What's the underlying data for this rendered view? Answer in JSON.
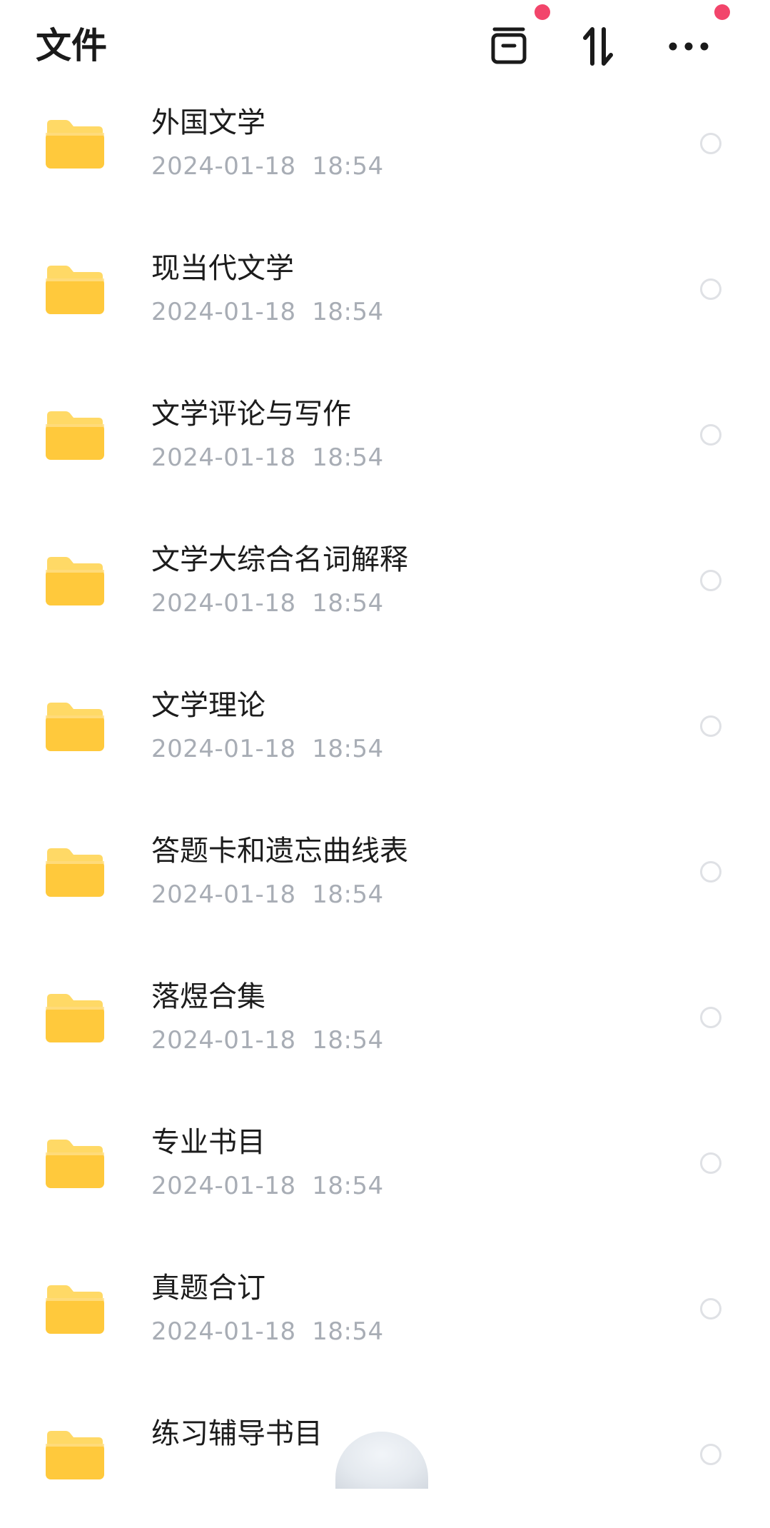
{
  "header": {
    "title": "文件"
  },
  "folders": [
    {
      "name": "外国文学",
      "date": "2024-01-18  18:54"
    },
    {
      "name": "现当代文学",
      "date": "2024-01-18  18:54"
    },
    {
      "name": "文学评论与写作",
      "date": "2024-01-18  18:54"
    },
    {
      "name": "文学大综合名词解释",
      "date": "2024-01-18  18:54"
    },
    {
      "name": "文学理论",
      "date": "2024-01-18  18:54"
    },
    {
      "name": "答题卡和遗忘曲线表",
      "date": "2024-01-18  18:54"
    },
    {
      "name": "落煜合集",
      "date": "2024-01-18  18:54"
    },
    {
      "name": "专业书目",
      "date": "2024-01-18  18:54"
    },
    {
      "name": "真题合订",
      "date": "2024-01-18  18:54"
    },
    {
      "name": "练习辅导书目",
      "date": ""
    }
  ],
  "icons": {
    "folder": "folder-icon",
    "archive": "archive-icon",
    "sort": "sort-icon",
    "more": "more-icon",
    "select": "radio-circle-icon"
  },
  "colors": {
    "folder_top": "#ffd966",
    "folder_body": "#ffc93c",
    "notification_dot": "#f2456b",
    "date_text": "#a8adb5"
  }
}
